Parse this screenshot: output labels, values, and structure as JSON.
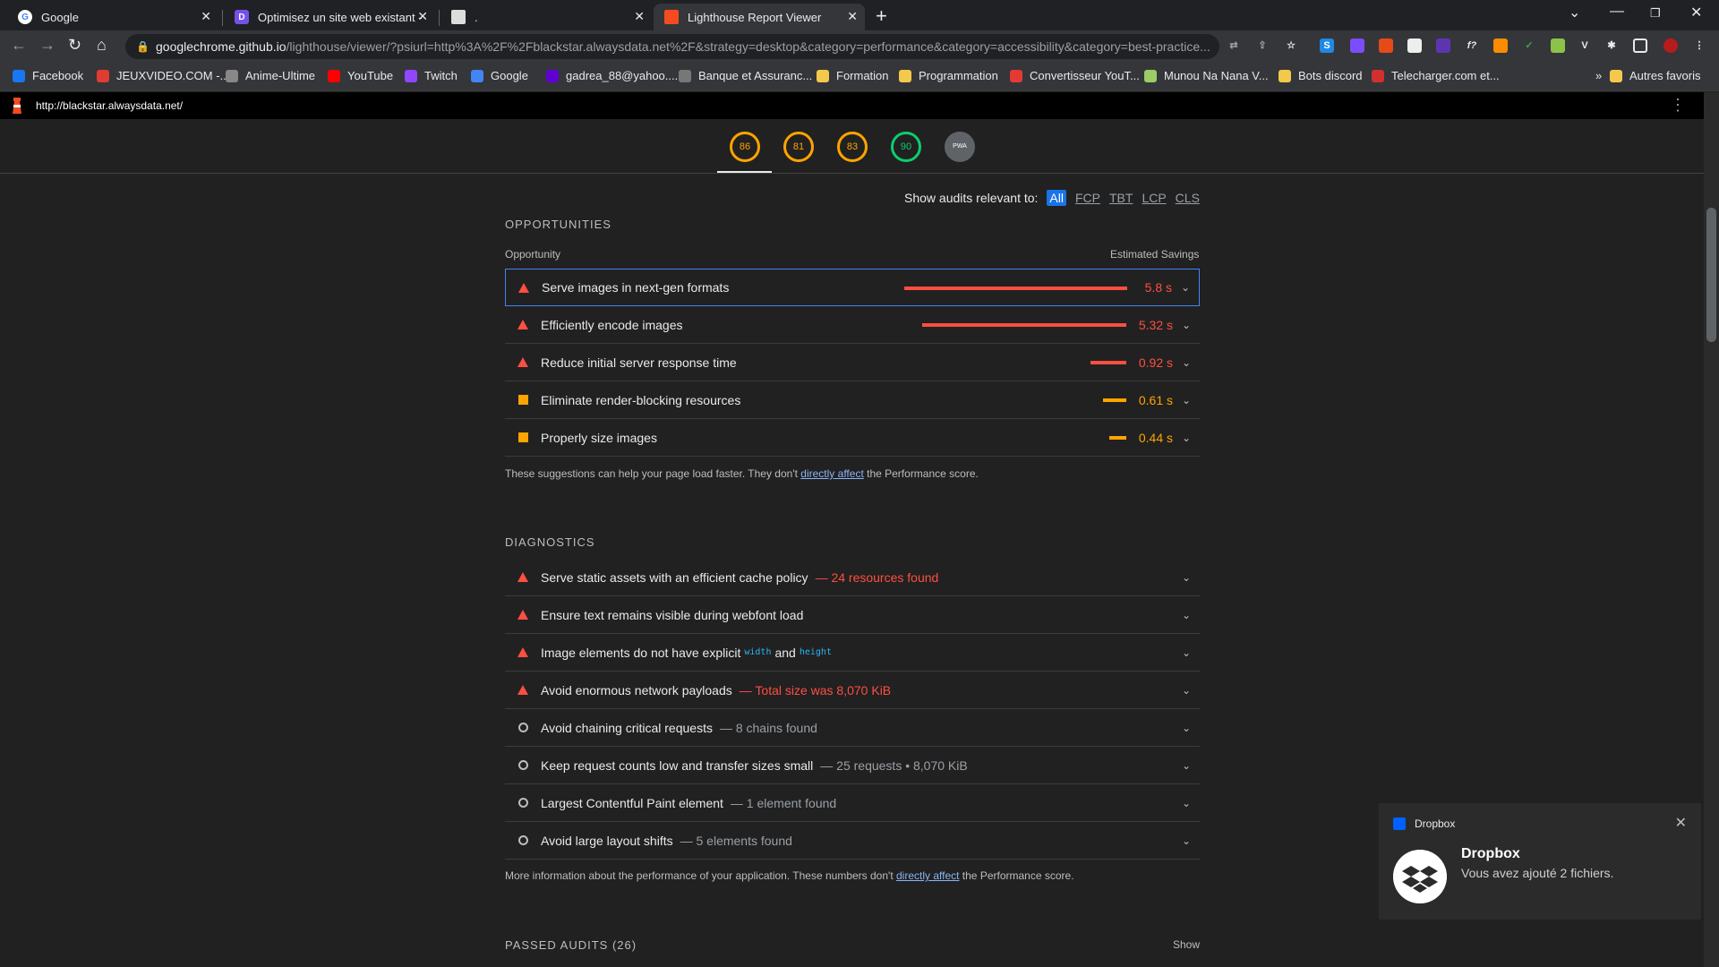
{
  "browser": {
    "tabs": [
      {
        "title": "Google",
        "favicon": "google-icon"
      },
      {
        "title": "Optimisez un site web existant - ",
        "favicon": "openclassrooms-icon"
      },
      {
        "title": ".",
        "favicon": "image-icon"
      },
      {
        "title": "Lighthouse Report Viewer",
        "favicon": "lighthouse-icon",
        "active": true
      }
    ],
    "url_host": "googlechrome.github.io",
    "url_path": "/lighthouse/viewer/?psiurl=http%3A%2F%2Fblackstar.alwaysdata.net%2F&strategy=desktop&category=performance&category=accessibility&category=best-practice...",
    "bookmarks": [
      {
        "label": "Facebook",
        "color": "#1877f2"
      },
      {
        "label": "JEUXVIDEO.COM -...",
        "color": "#e03c31"
      },
      {
        "label": "Anime-Ultime",
        "color": "#888888"
      },
      {
        "label": "YouTube",
        "color": "#ff0000"
      },
      {
        "label": "Twitch",
        "color": "#9146ff"
      },
      {
        "label": "Google",
        "color": "#4285f4"
      },
      {
        "label": "gadrea_88@yahoo....",
        "color": "#6001d2"
      },
      {
        "label": "Banque et Assuranc...",
        "color": "#777777"
      },
      {
        "label": "Formation",
        "color": "#f2c94c"
      },
      {
        "label": "Programmation",
        "color": "#f2c94c"
      },
      {
        "label": "Convertisseur YouT...",
        "color": "#e53935"
      },
      {
        "label": "Munou Na Nana V...",
        "color": "#9ccc65"
      },
      {
        "label": "Bots discord",
        "color": "#f2c94c"
      },
      {
        "label": "Telecharger.com et...",
        "color": "#d32f2f"
      }
    ],
    "bookmarks_overflow": "»",
    "other_bookmarks": "Autres favoris"
  },
  "report": {
    "url": "http://blackstar.alwaysdata.net/",
    "gauges": [
      {
        "score": "86",
        "color": "#ffa400"
      },
      {
        "score": "81",
        "color": "#ffa400"
      },
      {
        "score": "83",
        "color": "#ffa400"
      },
      {
        "score": "90",
        "color": "#0cce6b"
      },
      {
        "score": "PWA",
        "color": "#9aa0a6"
      }
    ],
    "filter": {
      "label": "Show audits relevant to:",
      "options": [
        "All",
        "FCP",
        "TBT",
        "LCP",
        "CLS"
      ]
    },
    "opportunities": {
      "title": "OPPORTUNITIES",
      "col_left": "Opportunity",
      "col_right": "Estimated Savings",
      "items": [
        {
          "title": "Serve images in next-gen formats",
          "saving": "5.8 s",
          "severity": "fail",
          "fraction": 1.0
        },
        {
          "title": "Efficiently encode images",
          "saving": "5.32 s",
          "severity": "fail",
          "fraction": 0.917
        },
        {
          "title": "Reduce initial server response time",
          "saving": "0.92 s",
          "severity": "fail",
          "fraction": 0.159
        },
        {
          "title": "Eliminate render-blocking resources",
          "saving": "0.61 s",
          "severity": "average",
          "fraction": 0.105
        },
        {
          "title": "Properly size images",
          "saving": "0.44 s",
          "severity": "average",
          "fraction": 0.076
        }
      ],
      "note_before": "These suggestions can help your page load faster. They don't ",
      "note_link": "directly affect",
      "note_after": " the Performance score."
    },
    "diagnostics": {
      "title": "DIAGNOSTICS",
      "items": [
        {
          "title": "Serve static assets with an efficient cache policy",
          "detail": "— 24 resources found",
          "severity": "fail"
        },
        {
          "title": "Ensure text remains visible during webfont load",
          "detail": "",
          "severity": "fail"
        },
        {
          "title": "Image elements do not have explicit",
          "code1": "width",
          "and": "and",
          "code2": "height",
          "severity": "fail"
        },
        {
          "title": "Avoid enormous network payloads",
          "detail": "— Total size was 8,070 KiB",
          "severity": "fail"
        },
        {
          "title": "Avoid chaining critical requests",
          "detail": "— 8 chains found",
          "severity": "info"
        },
        {
          "title": "Keep request counts low and transfer sizes small",
          "detail": "— 25 requests • 8,070 KiB",
          "severity": "info"
        },
        {
          "title": "Largest Contentful Paint element",
          "detail": "— 1 element found",
          "severity": "info"
        },
        {
          "title": "Avoid large layout shifts",
          "detail": "— 5 elements found",
          "severity": "info"
        }
      ],
      "note_before": "More information about the performance of your application. These numbers don't ",
      "note_link": "directly affect",
      "note_after": " the Performance score."
    },
    "passed": {
      "title": "PASSED AUDITS (26)",
      "show": "Show"
    }
  },
  "toast": {
    "app": "Dropbox",
    "title": "Dropbox",
    "message": "Vous avez ajouté 2 fichiers."
  }
}
